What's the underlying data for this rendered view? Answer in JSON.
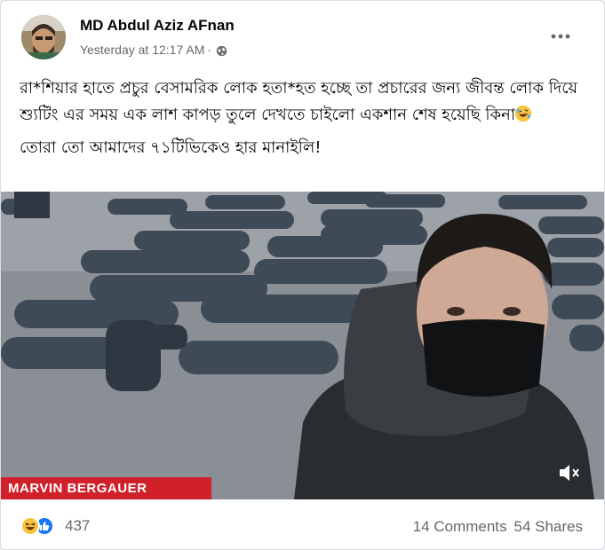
{
  "post": {
    "author": "MD Abdul Aziz AFnan",
    "timestamp": "Yesterday at 12:17 AM",
    "separator": "·",
    "audience_icon": "globe-icon",
    "more_icon": "more-options-icon",
    "text": {
      "line1": "রা*শিয়ার হাতে প্রচুর বেসামরিক লোক হতা*হত হচ্ছে তা প্রচারের জন্য জীবন্ত লোক দিয়ে শ্যুটিং এর সময় এক লাশ কাপড় তুলে দেখতে চাইলো একশান শেষ হয়েছি কিনা",
      "emoji": "rolling-on-floor-laughing-emoji",
      "line2": "তোরা তো আমাদের ৭১টিভিকেও হার মানাইলি!"
    },
    "video": {
      "lower_third": "MARVIN BERGAUER",
      "mute_icon": "speaker-muted-icon"
    }
  },
  "footer": {
    "reaction_icons": [
      "haha-reaction-icon",
      "like-reaction-icon"
    ],
    "reaction_count": "437",
    "comments": "14 Comments",
    "shares": "54 Shares"
  },
  "colors": {
    "primary_text": "#050505",
    "secondary_text": "#65676b",
    "like_blue": "#1877f2",
    "haha_yellow": "#f7c33c",
    "card_border": "#dadde1"
  }
}
